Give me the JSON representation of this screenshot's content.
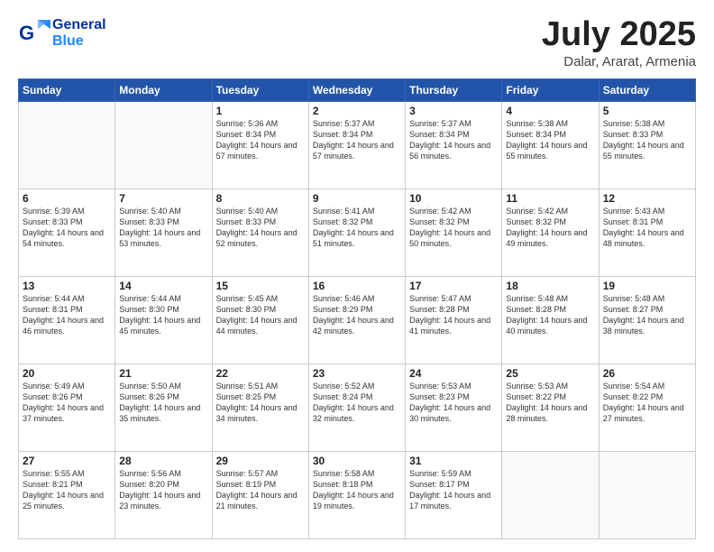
{
  "header": {
    "logo_general": "General",
    "logo_blue": "Blue",
    "month_title": "July 2025",
    "location": "Dalar, Ararat, Armenia"
  },
  "weekdays": [
    "Sunday",
    "Monday",
    "Tuesday",
    "Wednesday",
    "Thursday",
    "Friday",
    "Saturday"
  ],
  "weeks": [
    [
      {
        "day": "",
        "sunrise": "",
        "sunset": "",
        "daylight": ""
      },
      {
        "day": "",
        "sunrise": "",
        "sunset": "",
        "daylight": ""
      },
      {
        "day": "1",
        "sunrise": "Sunrise: 5:36 AM",
        "sunset": "Sunset: 8:34 PM",
        "daylight": "Daylight: 14 hours and 57 minutes."
      },
      {
        "day": "2",
        "sunrise": "Sunrise: 5:37 AM",
        "sunset": "Sunset: 8:34 PM",
        "daylight": "Daylight: 14 hours and 57 minutes."
      },
      {
        "day": "3",
        "sunrise": "Sunrise: 5:37 AM",
        "sunset": "Sunset: 8:34 PM",
        "daylight": "Daylight: 14 hours and 56 minutes."
      },
      {
        "day": "4",
        "sunrise": "Sunrise: 5:38 AM",
        "sunset": "Sunset: 8:34 PM",
        "daylight": "Daylight: 14 hours and 55 minutes."
      },
      {
        "day": "5",
        "sunrise": "Sunrise: 5:38 AM",
        "sunset": "Sunset: 8:33 PM",
        "daylight": "Daylight: 14 hours and 55 minutes."
      }
    ],
    [
      {
        "day": "6",
        "sunrise": "Sunrise: 5:39 AM",
        "sunset": "Sunset: 8:33 PM",
        "daylight": "Daylight: 14 hours and 54 minutes."
      },
      {
        "day": "7",
        "sunrise": "Sunrise: 5:40 AM",
        "sunset": "Sunset: 8:33 PM",
        "daylight": "Daylight: 14 hours and 53 minutes."
      },
      {
        "day": "8",
        "sunrise": "Sunrise: 5:40 AM",
        "sunset": "Sunset: 8:33 PM",
        "daylight": "Daylight: 14 hours and 52 minutes."
      },
      {
        "day": "9",
        "sunrise": "Sunrise: 5:41 AM",
        "sunset": "Sunset: 8:32 PM",
        "daylight": "Daylight: 14 hours and 51 minutes."
      },
      {
        "day": "10",
        "sunrise": "Sunrise: 5:42 AM",
        "sunset": "Sunset: 8:32 PM",
        "daylight": "Daylight: 14 hours and 50 minutes."
      },
      {
        "day": "11",
        "sunrise": "Sunrise: 5:42 AM",
        "sunset": "Sunset: 8:32 PM",
        "daylight": "Daylight: 14 hours and 49 minutes."
      },
      {
        "day": "12",
        "sunrise": "Sunrise: 5:43 AM",
        "sunset": "Sunset: 8:31 PM",
        "daylight": "Daylight: 14 hours and 48 minutes."
      }
    ],
    [
      {
        "day": "13",
        "sunrise": "Sunrise: 5:44 AM",
        "sunset": "Sunset: 8:31 PM",
        "daylight": "Daylight: 14 hours and 46 minutes."
      },
      {
        "day": "14",
        "sunrise": "Sunrise: 5:44 AM",
        "sunset": "Sunset: 8:30 PM",
        "daylight": "Daylight: 14 hours and 45 minutes."
      },
      {
        "day": "15",
        "sunrise": "Sunrise: 5:45 AM",
        "sunset": "Sunset: 8:30 PM",
        "daylight": "Daylight: 14 hours and 44 minutes."
      },
      {
        "day": "16",
        "sunrise": "Sunrise: 5:46 AM",
        "sunset": "Sunset: 8:29 PM",
        "daylight": "Daylight: 14 hours and 42 minutes."
      },
      {
        "day": "17",
        "sunrise": "Sunrise: 5:47 AM",
        "sunset": "Sunset: 8:28 PM",
        "daylight": "Daylight: 14 hours and 41 minutes."
      },
      {
        "day": "18",
        "sunrise": "Sunrise: 5:48 AM",
        "sunset": "Sunset: 8:28 PM",
        "daylight": "Daylight: 14 hours and 40 minutes."
      },
      {
        "day": "19",
        "sunrise": "Sunrise: 5:48 AM",
        "sunset": "Sunset: 8:27 PM",
        "daylight": "Daylight: 14 hours and 38 minutes."
      }
    ],
    [
      {
        "day": "20",
        "sunrise": "Sunrise: 5:49 AM",
        "sunset": "Sunset: 8:26 PM",
        "daylight": "Daylight: 14 hours and 37 minutes."
      },
      {
        "day": "21",
        "sunrise": "Sunrise: 5:50 AM",
        "sunset": "Sunset: 8:26 PM",
        "daylight": "Daylight: 14 hours and 35 minutes."
      },
      {
        "day": "22",
        "sunrise": "Sunrise: 5:51 AM",
        "sunset": "Sunset: 8:25 PM",
        "daylight": "Daylight: 14 hours and 34 minutes."
      },
      {
        "day": "23",
        "sunrise": "Sunrise: 5:52 AM",
        "sunset": "Sunset: 8:24 PM",
        "daylight": "Daylight: 14 hours and 32 minutes."
      },
      {
        "day": "24",
        "sunrise": "Sunrise: 5:53 AM",
        "sunset": "Sunset: 8:23 PM",
        "daylight": "Daylight: 14 hours and 30 minutes."
      },
      {
        "day": "25",
        "sunrise": "Sunrise: 5:53 AM",
        "sunset": "Sunset: 8:22 PM",
        "daylight": "Daylight: 14 hours and 28 minutes."
      },
      {
        "day": "26",
        "sunrise": "Sunrise: 5:54 AM",
        "sunset": "Sunset: 8:22 PM",
        "daylight": "Daylight: 14 hours and 27 minutes."
      }
    ],
    [
      {
        "day": "27",
        "sunrise": "Sunrise: 5:55 AM",
        "sunset": "Sunset: 8:21 PM",
        "daylight": "Daylight: 14 hours and 25 minutes."
      },
      {
        "day": "28",
        "sunrise": "Sunrise: 5:56 AM",
        "sunset": "Sunset: 8:20 PM",
        "daylight": "Daylight: 14 hours and 23 minutes."
      },
      {
        "day": "29",
        "sunrise": "Sunrise: 5:57 AM",
        "sunset": "Sunset: 8:19 PM",
        "daylight": "Daylight: 14 hours and 21 minutes."
      },
      {
        "day": "30",
        "sunrise": "Sunrise: 5:58 AM",
        "sunset": "Sunset: 8:18 PM",
        "daylight": "Daylight: 14 hours and 19 minutes."
      },
      {
        "day": "31",
        "sunrise": "Sunrise: 5:59 AM",
        "sunset": "Sunset: 8:17 PM",
        "daylight": "Daylight: 14 hours and 17 minutes."
      },
      {
        "day": "",
        "sunrise": "",
        "sunset": "",
        "daylight": ""
      },
      {
        "day": "",
        "sunrise": "",
        "sunset": "",
        "daylight": ""
      }
    ]
  ]
}
